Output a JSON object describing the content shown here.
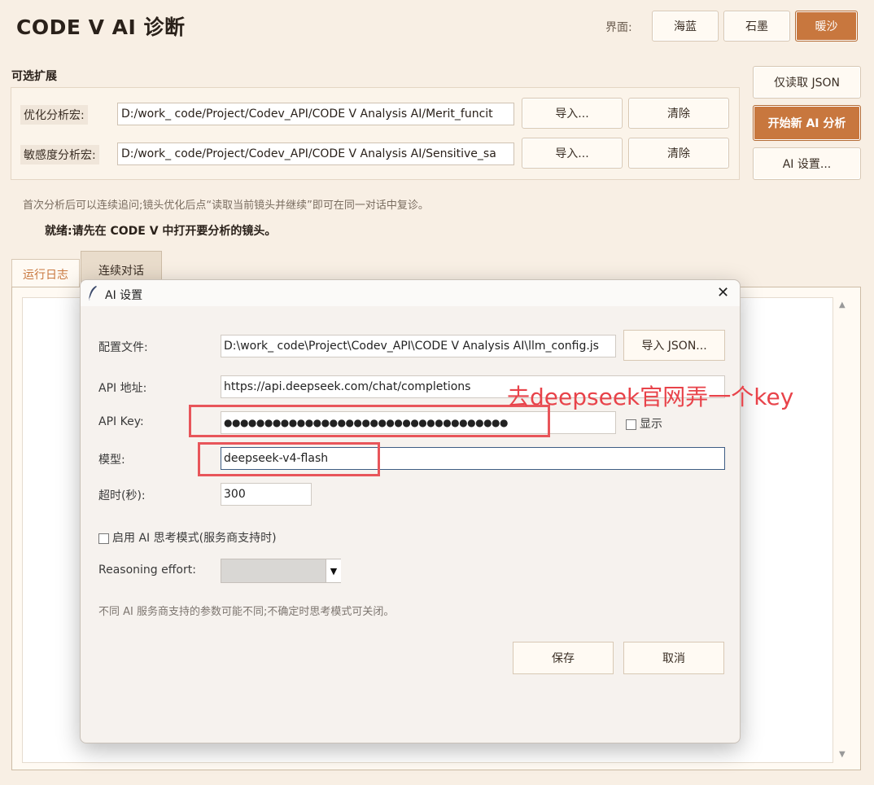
{
  "app": {
    "title": "CODE V AI 诊断",
    "theme_label": "界面:",
    "themes": [
      "海蓝",
      "石墨",
      "暖沙"
    ],
    "active_theme": "暖沙"
  },
  "side_buttons": {
    "read_json": "仅读取 JSON",
    "start_analysis": "开始新 AI 分析",
    "ai_settings": "AI 设置..."
  },
  "extensions": {
    "section_title": "可选扩展",
    "rows": [
      {
        "label": "优化分析宏:",
        "path": "D:/work_ code/Project/Codev_API/CODE V Analysis AI/Merit_funcit",
        "import": "导入...",
        "clear": "清除"
      },
      {
        "label": "敏感度分析宏:",
        "path": "D:/work_ code/Project/Codev_API/CODE V Analysis AI/Sensitive_sa",
        "import": "导入...",
        "clear": "清除"
      }
    ]
  },
  "hint": "首次分析后可以连续追问;镜头优化后点“读取当前镜头并继续”即可在同一对话中复诊。",
  "status": "就绪:请先在 CODE V 中打开要分析的镜头。",
  "tabs": {
    "log": "运行日志",
    "chat": "连续对话"
  },
  "dialog": {
    "title": "AI 设置",
    "config_label": "配置文件:",
    "config_value": "D:\\work_ code\\Project\\Codev_API\\CODE V Analysis AI\\llm_config.js",
    "import_json": "导入 JSON...",
    "api_url_label": "API 地址:",
    "api_url_value": "https://api.deepseek.com/chat/completions",
    "api_key_label": "API Key:",
    "api_key_value": "●●●●●●●●●●●●●●●●●●●●●●●●●●●●●●●●●●●",
    "show_label": "显示",
    "model_label": "模型:",
    "model_value": "deepseek-v4-flash",
    "timeout_label": "超时(秒):",
    "timeout_value": "300",
    "thinking_label": "启用 AI 思考模式(服务商支持时)",
    "reasoning_label": "Reasoning effort:",
    "note": "不同 AI 服务商支持的参数可能不同;不确定时思考模式可关闭。",
    "save": "保存",
    "cancel": "取消"
  },
  "annotation": "去deepseek官网弄一个key",
  "colors": {
    "accent": "#c8773e",
    "background": "#f8efe4",
    "annotation_red": "#e8434a"
  }
}
